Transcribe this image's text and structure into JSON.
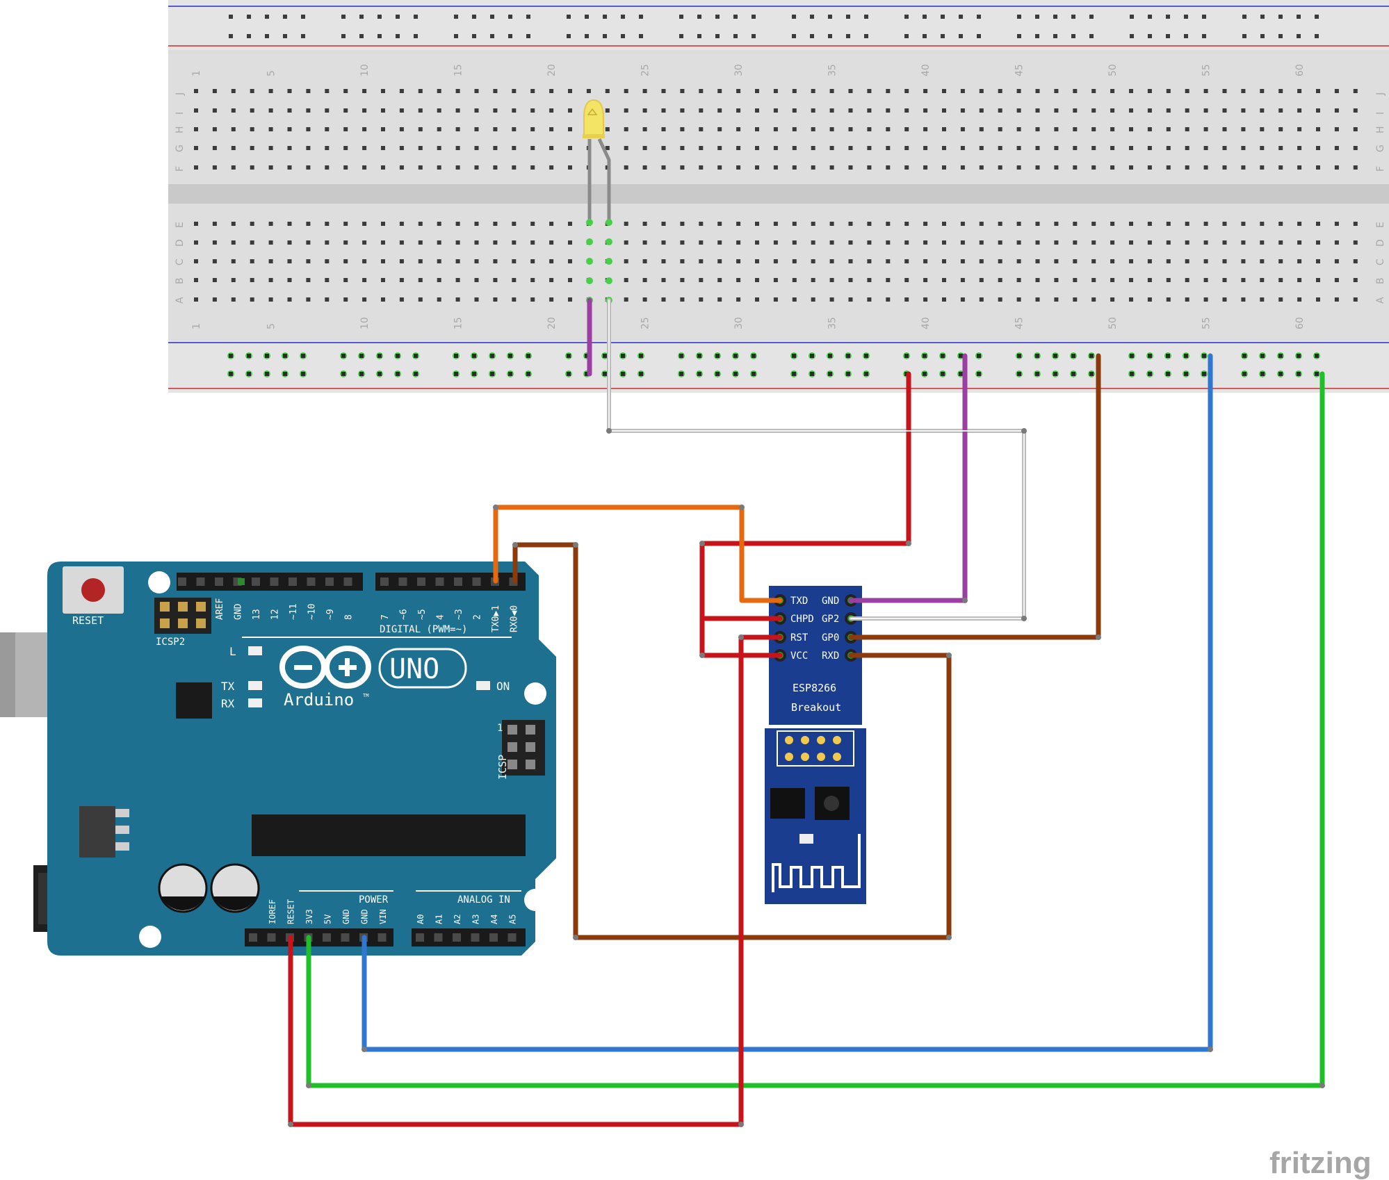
{
  "breadboard": {
    "column_numbers": [
      "1",
      "5",
      "10",
      "15",
      "20",
      "25",
      "30",
      "35",
      "40",
      "45",
      "50",
      "55",
      "60"
    ],
    "row_letters_top": [
      "J",
      "I",
      "H",
      "G",
      "F"
    ],
    "row_letters_bottom": [
      "E",
      "D",
      "C",
      "B",
      "A"
    ]
  },
  "arduino": {
    "reset_label": "RESET",
    "icsp2_label": "ICSP2",
    "icsp_label": "ICSP",
    "icsp_pin1": "1",
    "aref_label": "AREF",
    "gnd_top_label": "GND",
    "digital_pins_left": [
      "13",
      "12",
      "~11",
      "~10",
      "~9",
      "8"
    ],
    "digital_pins_right": [
      "7",
      "~6",
      "~5",
      "4",
      "~3",
      "2",
      "TX0▶1",
      "RX0◀0"
    ],
    "digital_label": "DIGITAL (PWM=~)",
    "led_l": "L",
    "led_tx": "TX",
    "led_rx": "RX",
    "led_on": "ON",
    "uno_label": "UNO",
    "brand": "Arduino",
    "tm": "TM",
    "power_label": "POWER",
    "analog_label": "ANALOG IN",
    "power_pins": [
      "IOREF",
      "RESET",
      "3V3",
      "5V",
      "GND",
      "GND",
      "VIN"
    ],
    "analog_pins": [
      "A0",
      "A1",
      "A2",
      "A3",
      "A4",
      "A5"
    ]
  },
  "esp8266": {
    "left_pins": [
      "TXD",
      "CHPD",
      "RST",
      "VCC"
    ],
    "right_pins": [
      "GND",
      "GP2",
      "GP0",
      "RXD"
    ],
    "title": "ESP8266",
    "subtitle": "Breakout"
  },
  "wire_colors": {
    "red": "#c7131a",
    "purple": "#9b3fa2",
    "brown": "#8a3a0c",
    "blue": "#2f77d1",
    "green": "#1fbf2a",
    "orange": "#e6690f",
    "white": "#d8d8d8",
    "board_teal": "#1d7090",
    "esp_blue": "#1a3d8f"
  },
  "watermark": "fritzing"
}
